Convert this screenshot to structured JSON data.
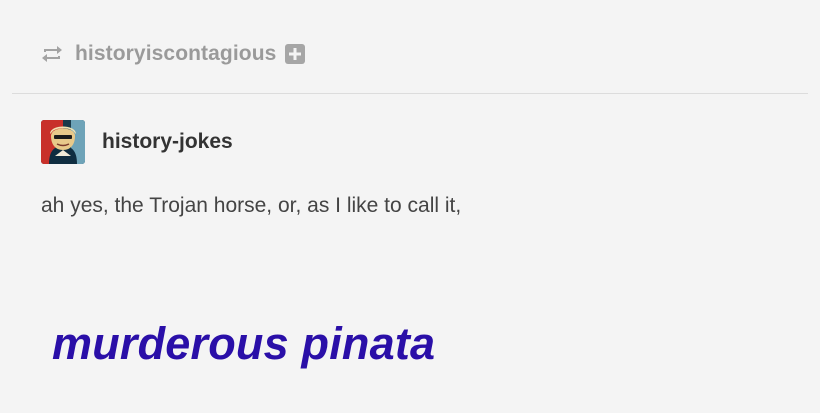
{
  "reblog": {
    "icon": "reblog-icon",
    "username": "historyiscontagious",
    "follow_icon": "plus-box-icon"
  },
  "author": {
    "avatar": "avatar",
    "username": "history-jokes"
  },
  "post": {
    "text": "ah yes, the Trojan horse, or, as I like to call it,",
    "punchline": "murderous pinata"
  },
  "colors": {
    "background": "#f4f4f4",
    "muted_text": "#9a9a9a",
    "author_text": "#333333",
    "body_text": "#444444",
    "punchline": "#2a0fa8"
  }
}
